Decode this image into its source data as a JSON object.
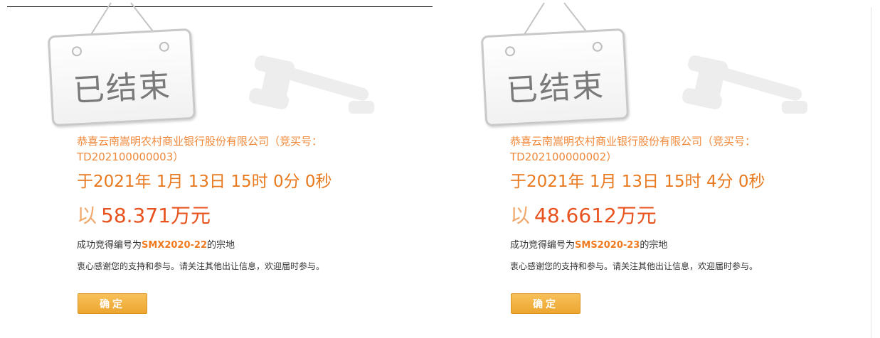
{
  "panels": [
    {
      "sign_text": "已结束",
      "winner": "恭喜云南嵩明农村商业银行股份有限公司（竞买号：TD202100000003）",
      "time": "于2021年 1月 13日 15时 0分 0秒",
      "price_prefix": "以",
      "price": "58.371万元",
      "result_prefix": "成功竞得编号为",
      "parcel_code": "SMX2020-22",
      "result_suffix": "的宗地",
      "thanks": "衷心感谢您的支持和参与。请关注其他出让信息，欢迎届时参与。",
      "ok_label": "确定"
    },
    {
      "sign_text": "已结束",
      "winner": "恭喜云南嵩明农村商业银行股份有限公司（竞买号：TD202100000002）",
      "time": "于2021年 1月 13日 15时 4分 0秒",
      "price_prefix": "以",
      "price": "48.6612万元",
      "result_prefix": "成功竞得编号为",
      "parcel_code": "SMS2020-23",
      "result_suffix": "的宗地",
      "thanks": "衷心感谢您的支持和参与。请关注其他出让信息，欢迎届时参与。",
      "ok_label": "确定"
    }
  ],
  "icons": {
    "sign": "ended-sign-icon",
    "watermark": "gavel-icon"
  },
  "colors": {
    "accent": "#e8521e",
    "button": "#eca630",
    "text_orange": "#f0883a"
  }
}
